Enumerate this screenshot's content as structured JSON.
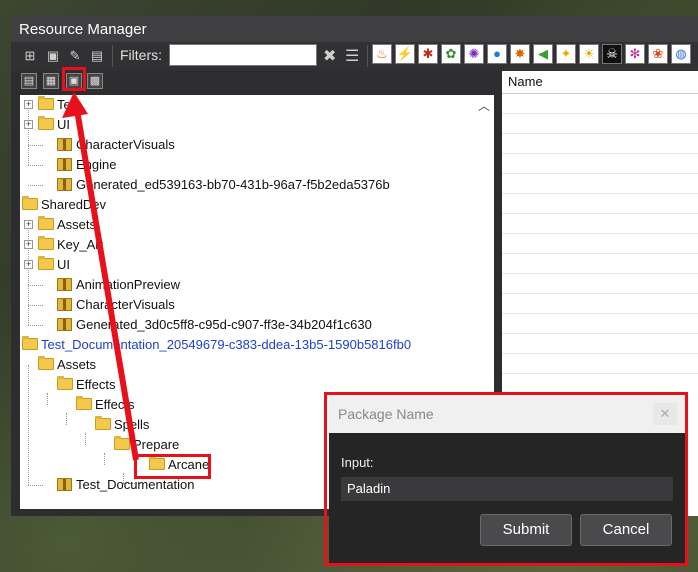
{
  "window": {
    "title": "Resource Manager"
  },
  "toolbar": {
    "filters_label": "Filters:",
    "filter_value": "",
    "clear_icon": "close-icon",
    "filter_options_icon": "filter-lines-icon",
    "type_filter_icons": [
      "fire",
      "lightning-sword",
      "spider",
      "beetle",
      "virus",
      "orb",
      "starburst",
      "speaker",
      "bulb",
      "sun",
      "skull",
      "swirl",
      "paw",
      "globe"
    ]
  },
  "subtoolbar": {
    "icons": [
      "save-icon",
      "package-icon",
      "add-package-icon",
      "package-settings-icon"
    ]
  },
  "tree": {
    "rows": [
      {
        "label": "Test"
      },
      {
        "label": "UI"
      },
      {
        "label": "CharacterVisuals"
      },
      {
        "label": "Engine"
      },
      {
        "label": "Generated_ed539163-bb70-431b-96a7-f5b2eda5376b"
      },
      {
        "label": "SharedDev"
      },
      {
        "label": "Assets"
      },
      {
        "label": "Key_Art"
      },
      {
        "label": "UI"
      },
      {
        "label": "AnimationPreview"
      },
      {
        "label": "CharacterVisuals"
      },
      {
        "label": "Generated_3d0c5ff8-c95d-c907-ff3e-34b204f1c630"
      },
      {
        "label": "Test_Documentation_20549679-c383-ddea-13b5-1590b5816fb0"
      },
      {
        "label": "Assets"
      },
      {
        "label": "Effects"
      },
      {
        "label": "Effects"
      },
      {
        "label": "Spells"
      },
      {
        "label": "Prepare"
      },
      {
        "label": "Arcane"
      },
      {
        "label": "Test_Documentation"
      }
    ]
  },
  "right_panel": {
    "column_header": "Name"
  },
  "dialog": {
    "title": "Package Name",
    "input_label": "Input:",
    "input_value": "Paladin",
    "submit_label": "Submit",
    "cancel_label": "Cancel"
  },
  "colors": {
    "highlight": "#e8111b",
    "link": "#1f3fd0"
  }
}
